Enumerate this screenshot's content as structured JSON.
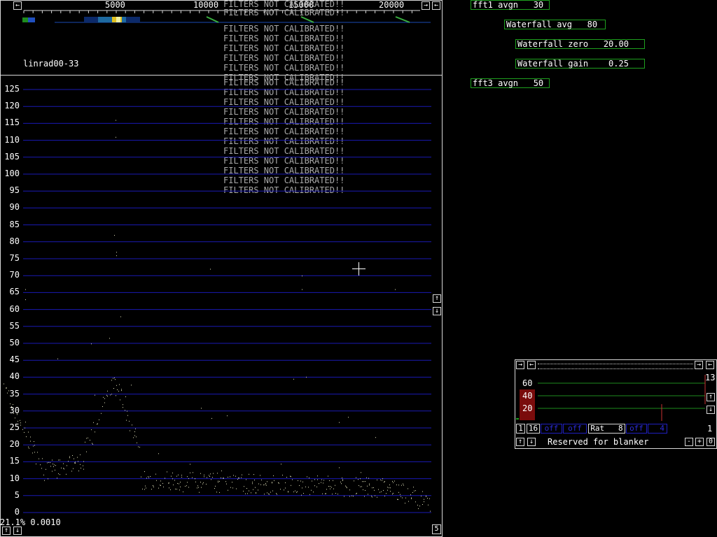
{
  "spectrum": {
    "freq_labels": [
      "5000",
      "10000",
      "15000",
      "20000"
    ],
    "device_label": "linrad00-33",
    "y_labels": [
      "125",
      "120",
      "115",
      "110",
      "105",
      "100",
      "95",
      "90",
      "85",
      "80",
      "75",
      "70",
      "65",
      "60",
      "55",
      "50",
      "45",
      "40",
      "35",
      "30",
      "25",
      "20",
      "15",
      "10",
      "5",
      "0"
    ],
    "warning_text": "FILTERS NOT CALIBRATED!!",
    "status_text": "21.1% 0.0010",
    "corner_value": "5",
    "arrow_up": "↑",
    "arrow_down": "↓",
    "arrow_left": "←",
    "arrow_right": "→"
  },
  "controls": {
    "fft1_avgn": "fft1 avgn   30",
    "waterfall_avg": "Waterfall avg   80",
    "waterfall_zero": "Waterfall zero   20.00",
    "waterfall_gain": "Waterfall gain    0.25",
    "fft3_avgn": "fft3 avgn   50"
  },
  "blanker": {
    "scale_labels": [
      "60",
      "40",
      "20"
    ],
    "side_value": "13",
    "count_value": "1",
    "btn_1": "1",
    "btn_16": "16",
    "off1": "off",
    "off2": "off",
    "rat": "Rat   8",
    "off3": "off",
    "num": "4",
    "reserved_text": "Reserved for blanker",
    "minus": "-",
    "plus": "+",
    "zero": "0"
  },
  "colors": {
    "grid": "#1a1ab4",
    "box_border": "#1ea01e",
    "marker_red": "#b41e1e",
    "dots": "#e6e6be"
  }
}
